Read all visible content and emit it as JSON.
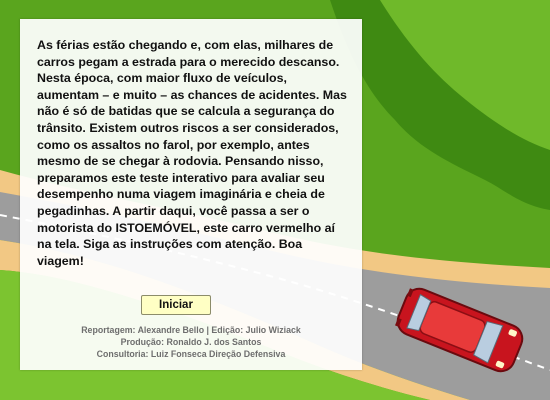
{
  "intro": {
    "text": "As férias estão chegando e, com elas, milhares de carros pegam a estrada para o merecido descanso. Nesta época, com maior fluxo de veículos, aumentam – e muito – as chances de acidentes. Mas não é só de batidas que se calcula a segurança do trânsito. Existem outros riscos a ser considerados, como os assaltos no farol, por exemplo, antes mesmo de se chegar à rodovia. Pensando nisso, preparamos este teste interativo para avaliar seu desempenho numa viagem imaginária e cheia de pegadinhas. A partir daqui, você passa a ser o motorista do ISTOEMÓVEL, este carro vermelho aí na tela. Siga as instruções com atenção. Boa viagem!"
  },
  "start_button": {
    "label": "Iniciar"
  },
  "credits": {
    "line1": "Reportagem: Alexandre Bello | Edição: Julio Wiziack",
    "line2": "Produção: Ronaldo J. dos Santos",
    "line3": "Consultoria: Luiz Fonseca Direção Defensiva"
  },
  "scene": {
    "colors": {
      "grass_light": "#7cc430",
      "grass_dark": "#3f8a12",
      "sand": "#f2c884",
      "road": "#9d9d9d",
      "lane_marking": "#ffffff",
      "car_body": "#c8141e",
      "car_roof": "#e83a3a",
      "car_glass": "#b9cde0"
    },
    "icons": [
      "red-car-icon",
      "tree-canopy-icon"
    ]
  }
}
